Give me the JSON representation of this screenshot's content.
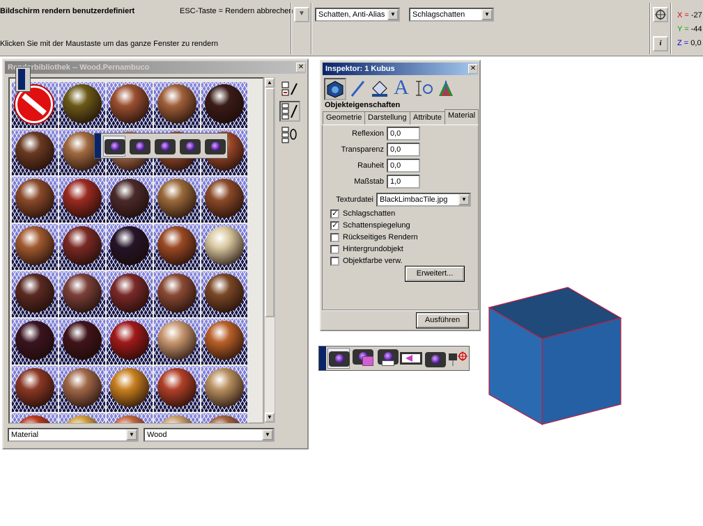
{
  "topbar": {
    "mode_title": "Bildschirm rendern benutzerdefiniert",
    "esc_hint": "ESC-Taste = Rendern abbrechen",
    "click_hint": "Klicken Sie mit der Maustaste um das ganze Fenster zu rendern",
    "shading_select": "Schatten, Anti-Alias",
    "shadow_select": "Schlagschatten",
    "coords": {
      "x_label": "X =",
      "x_value": "-27",
      "y_label": "Y =",
      "y_value": "-44",
      "z_label": "Z =",
      "z_value": "0,0"
    }
  },
  "library": {
    "title": "Renderbibliothek -- Wood.Pernambuco",
    "category_select": "Material",
    "family_select": "Wood",
    "spheres": [
      [
        "none",
        "#6b5a18",
        "#9a5030",
        "#a0603a",
        "#3a1c18"
      ],
      [
        "#6a3a22",
        "#a06a40",
        "#b07050",
        "#9a4a2a",
        "#a04a2a"
      ],
      [
        "#8a4a2a",
        "#9a2a20",
        "#4a2a2a",
        "#9a6a3a",
        "#8a4a28"
      ],
      [
        "#a05a30",
        "#7a2a24",
        "#241428",
        "#9a4a24",
        "#d8c8a0"
      ],
      [
        "#5a2a22",
        "#7a4038",
        "#7a2a28",
        "#8a4a34",
        "#7a4826"
      ],
      [
        "#3a1420",
        "#40141a",
        "#a01a1a",
        "#c89870",
        "#b86028"
      ],
      [
        "#8a3824",
        "#a06848",
        "#c88020",
        "#b04028",
        "#b89060"
      ],
      [
        "#b83a20",
        "#d0a040",
        "#c06840",
        "#c8a070",
        "#a06040"
      ]
    ]
  },
  "inspector": {
    "title": "Inspektor: 1 Kubus",
    "section": "Objekteigenschaften",
    "tabs": [
      "Geometrie",
      "Darstellung",
      "Attribute",
      "Material"
    ],
    "fields": [
      {
        "label": "Reflexion",
        "value": "0,0"
      },
      {
        "label": "Transparenz",
        "value": "0,0"
      },
      {
        "label": "Rauheit",
        "value": "0,0"
      },
      {
        "label": "Maßstab",
        "value": "1,0"
      }
    ],
    "texture_label": "Texturdatei",
    "texture_value": "BlackLimbacTile.jpg",
    "checkboxes": [
      {
        "label": "Schlagschatten",
        "checked": true
      },
      {
        "label": "Schattenspiegelung",
        "checked": true
      },
      {
        "label": "Rückseitiges Rendern",
        "checked": false
      },
      {
        "label": "Hintergrundobjekt",
        "checked": false
      },
      {
        "label": "Objektfarbe verw.",
        "checked": false
      }
    ],
    "advanced_button": "Erweitert...",
    "apply_button": "Ausführen"
  },
  "colors": {
    "cube_top": "#1f4a7a",
    "cube_left": "#2a6ab0",
    "cube_right": "#2560a4",
    "cube_edge": "#c02040"
  }
}
